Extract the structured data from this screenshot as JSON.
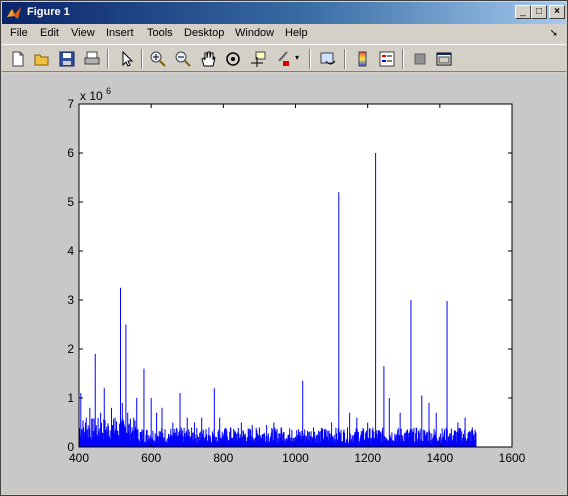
{
  "window": {
    "title": "Figure 1"
  },
  "menu": [
    "File",
    "Edit",
    "View",
    "Insert",
    "Tools",
    "Desktop",
    "Window",
    "Help"
  ],
  "toolbar_icons": [
    "new-figure-icon",
    "open-file-icon",
    "save-icon",
    "print-icon",
    "pointer-icon",
    "zoom-in-icon",
    "zoom-out-icon",
    "pan-icon",
    "rotate-3d-icon",
    "data-cursor-icon",
    "brush-icon",
    "brush-dropdown-icon",
    "link-plot-icon",
    "insert-colorbar-icon",
    "insert-legend-icon",
    "hide-plot-tools-icon",
    "show-plot-tools-icon"
  ],
  "colors": {
    "line": "#0000ff",
    "titlebar_start": "#0a246a",
    "titlebar_end": "#a6caf0",
    "figure_bg": "#c8c8c8"
  },
  "chart_data": {
    "type": "line",
    "title": "",
    "xlabel": "",
    "ylabel": "",
    "exponent_label": "x 10",
    "exponent_power": "6",
    "xlim": [
      400,
      1600
    ],
    "ylim": [
      0,
      7000000
    ],
    "xticks": [
      400,
      600,
      800,
      1000,
      1200,
      1400,
      1600
    ],
    "yticks": [
      0,
      1,
      2,
      3,
      4,
      5,
      6,
      7
    ],
    "grid": false,
    "series": [
      {
        "x": [
          405,
          420,
          430,
          445,
          460,
          470,
          490,
          500,
          515,
          520,
          530,
          535,
          560,
          580,
          600,
          615,
          630,
          660,
          680,
          700,
          720,
          740,
          760,
          775,
          790,
          820,
          850,
          880,
          900,
          920,
          940,
          960,
          990,
          1020,
          1050,
          1080,
          1100,
          1120,
          1150,
          1170,
          1200,
          1222,
          1245,
          1260,
          1290,
          1320,
          1350,
          1370,
          1390,
          1420,
          1450,
          1470,
          1490,
          1500
        ],
        "y": [
          1100000,
          600000,
          800000,
          1900000,
          700000,
          1200000,
          800000,
          600000,
          3250000,
          900000,
          2500000,
          700000,
          1000000,
          1600000,
          1000000,
          700000,
          800000,
          500000,
          1100000,
          600000,
          500000,
          600000,
          400000,
          1200000,
          600000,
          400000,
          500000,
          450000,
          400000,
          450000,
          500000,
          400000,
          350000,
          1350000,
          400000,
          350000,
          500000,
          5200000,
          700000,
          600000,
          500000,
          6000000,
          1650000,
          1000000,
          700000,
          3000000,
          1050000,
          900000,
          700000,
          2980000,
          500000,
          600000,
          400000,
          300000
        ]
      }
    ]
  }
}
